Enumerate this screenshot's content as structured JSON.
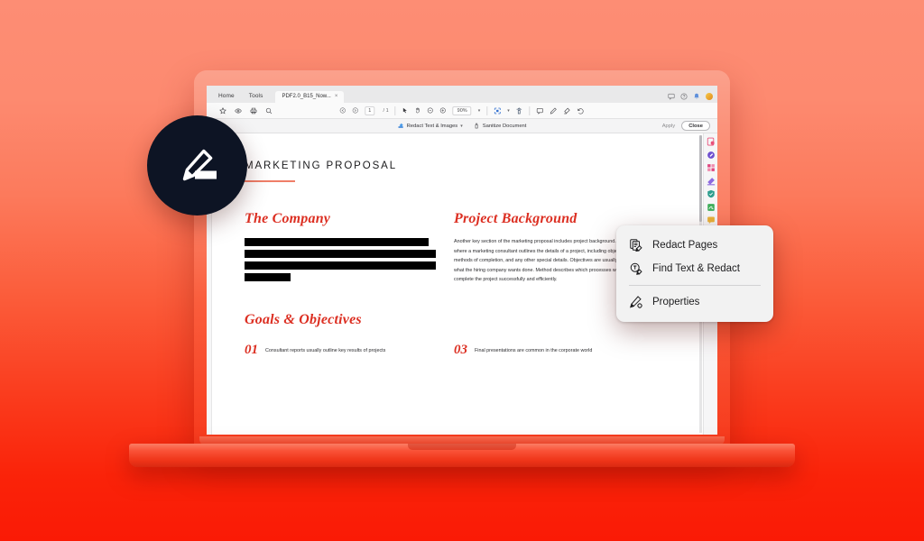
{
  "app": {
    "menus": [
      {
        "label": "Home"
      },
      {
        "label": "Tools"
      }
    ],
    "document_tab": {
      "label": "PDF2.0_B15_Now...",
      "close_label": "×"
    },
    "window_icons": [
      {
        "name": "comment-icon"
      },
      {
        "name": "help-icon"
      },
      {
        "name": "bell-icon"
      },
      {
        "name": "account-avatar"
      }
    ]
  },
  "toolbar": {
    "left_icons": [
      {
        "name": "bookmark-icon"
      },
      {
        "name": "eye-icon"
      },
      {
        "name": "print-icon"
      },
      {
        "name": "search-icon"
      }
    ],
    "nav": {
      "prev_label": "prev-page-icon",
      "next_label": "next-page-icon",
      "page_value": "1",
      "page_total": "/ 1"
    },
    "view_icons": [
      {
        "name": "select-cursor-icon"
      },
      {
        "name": "pan-hand-icon"
      },
      {
        "name": "zoom-out-icon"
      },
      {
        "name": "zoom-in-icon"
      }
    ],
    "zoom_value": "90%",
    "zoom_caret": "▾",
    "right_icons": [
      {
        "name": "fit-page-icon"
      },
      {
        "name": "rotate-view-icon"
      },
      {
        "name": "comment-box-icon"
      },
      {
        "name": "pen-icon"
      },
      {
        "name": "highlighter-icon"
      },
      {
        "name": "undo-icon"
      }
    ]
  },
  "redact_bar": {
    "items": [
      {
        "name": "redact-text-images",
        "label": "Redact Text & Images",
        "caret": "▾"
      },
      {
        "name": "sanitize-document",
        "label": "Sanitize Document"
      }
    ],
    "apply_label": "Apply",
    "close_label": "Close"
  },
  "document": {
    "title": "MARKETING PROPOSAL",
    "left_column": {
      "heading": "The Company",
      "redactions": [
        {
          "width_pct": 96
        },
        {
          "width_pct": 100
        },
        {
          "width_pct": 100
        },
        {
          "width_pct": 24
        }
      ]
    },
    "right_column": {
      "heading": "Project Background",
      "body": "Another key section of the marketing proposal includes project background. This is where a marketing consultant outlines the details of a project, including objectives, methods of completion, and any other special details. Objectives are usually reflective of what the hiring company wants done. Method describes which processes will be used to complete the project successfully and efficiently."
    },
    "goals": {
      "heading": "Goals & Objectives",
      "items": [
        {
          "number": "01",
          "text": "Consultant reports usually outline key results of projects"
        },
        {
          "number": "03",
          "text": "Final presentations are common in the corporate world"
        }
      ]
    }
  },
  "tool_rail": {
    "tools": [
      {
        "name": "tool-export-pdf",
        "color": "#e8507a"
      },
      {
        "name": "tool-edit-pdf",
        "color": "#6e4fd0"
      },
      {
        "name": "tool-organize-pages",
        "color": "#e0467f"
      },
      {
        "name": "tool-redact",
        "color": "#8d6ae0"
      },
      {
        "name": "tool-protect",
        "color": "#2f9e8f"
      },
      {
        "name": "tool-fill-sign",
        "color": "#3fae5a"
      },
      {
        "name": "tool-comment",
        "color": "#e8b23a"
      }
    ]
  },
  "context_menu": {
    "items": [
      {
        "name": "redact-pages",
        "label": "Redact Pages",
        "icon": "redact-pages-icon"
      },
      {
        "name": "find-text-redact",
        "label": "Find Text & Redact",
        "icon": "find-redact-icon"
      },
      {
        "name": "properties",
        "label": "Properties",
        "icon": "properties-icon"
      }
    ]
  },
  "branding": {
    "badge_icon": "highlighter-marker-icon"
  },
  "colors": {
    "background_top": "#fd8d74",
    "background_bottom": "#fa1a05",
    "accent_red": "#dc2f22",
    "title_rule": "#ef7e68",
    "badge_bg": "#0d1424"
  }
}
